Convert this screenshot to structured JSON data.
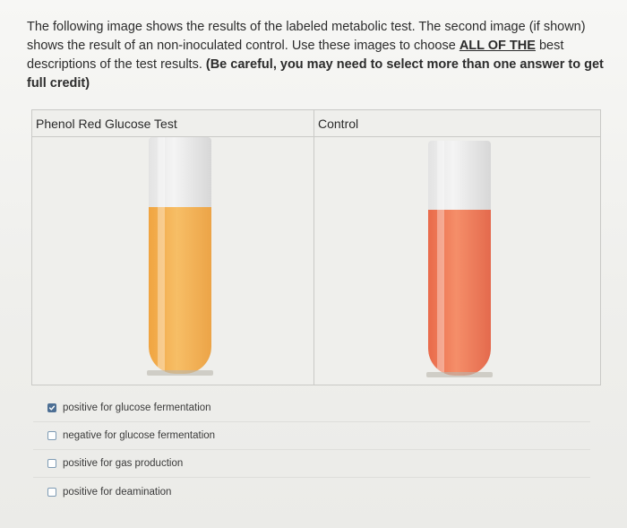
{
  "question": {
    "part1": "The following image shows the results of the labeled metabolic test. The second image (if shown) shows the result of an non-inoculated control.  Use these images to choose ",
    "emphasis_underline": "ALL OF THE",
    "part2": " best descriptions of the test results. ",
    "emphasis_bold": "(Be careful, you may need to select more than one answer to get full credit)"
  },
  "images": {
    "left_label": "Phenol Red Glucose Test",
    "right_label": "Control"
  },
  "tubes": {
    "test_color": "#f5b555",
    "control_color": "#f2805e"
  },
  "answers": [
    {
      "label": "positive for glucose fermentation",
      "checked": true
    },
    {
      "label": "negative for glucose fermentation",
      "checked": false
    },
    {
      "label": "positive for gas production",
      "checked": false
    },
    {
      "label": "positive for deamination",
      "checked": false
    }
  ],
  "colors": {
    "checkbox_checked": "#4d6f94",
    "checkbox_border": "#7e9bb4"
  }
}
